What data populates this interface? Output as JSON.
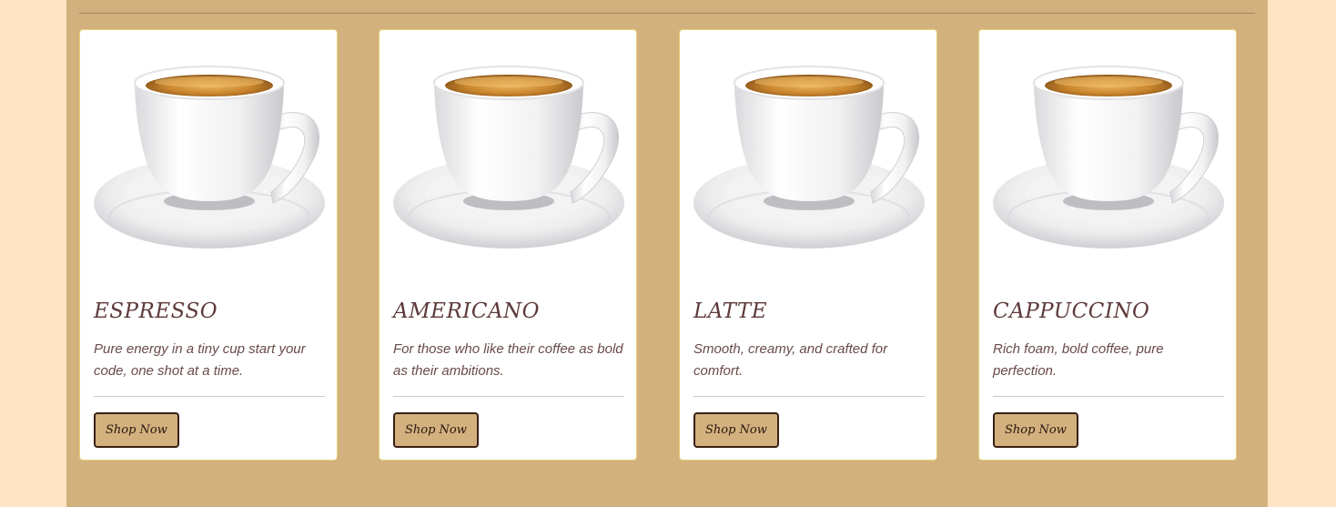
{
  "cards": [
    {
      "title": "ESPRESSO",
      "description": "Pure energy in a tiny cup start your code, one shot at a time.",
      "button_label": "Shop Now"
    },
    {
      "title": "AMERICANO",
      "description": "For those who like their coffee as bold as their ambitions.",
      "button_label": "Shop Now"
    },
    {
      "title": "LATTE",
      "description": "Smooth, creamy, and crafted for comfort.",
      "button_label": "Shop Now"
    },
    {
      "title": "CAPPUCCINO",
      "description": "Rich foam, bold coffee, pure perfection.",
      "button_label": "Shop Now"
    }
  ],
  "colors": {
    "page_background": "#FFE4C4",
    "section_background": "#D2B17F",
    "card_border": "#E5CF71",
    "title_text": "#5E3A3A",
    "button_background": "#D2B17F",
    "button_border": "#3A1F14"
  },
  "icons": {
    "product_image": "coffee-cup-image"
  }
}
